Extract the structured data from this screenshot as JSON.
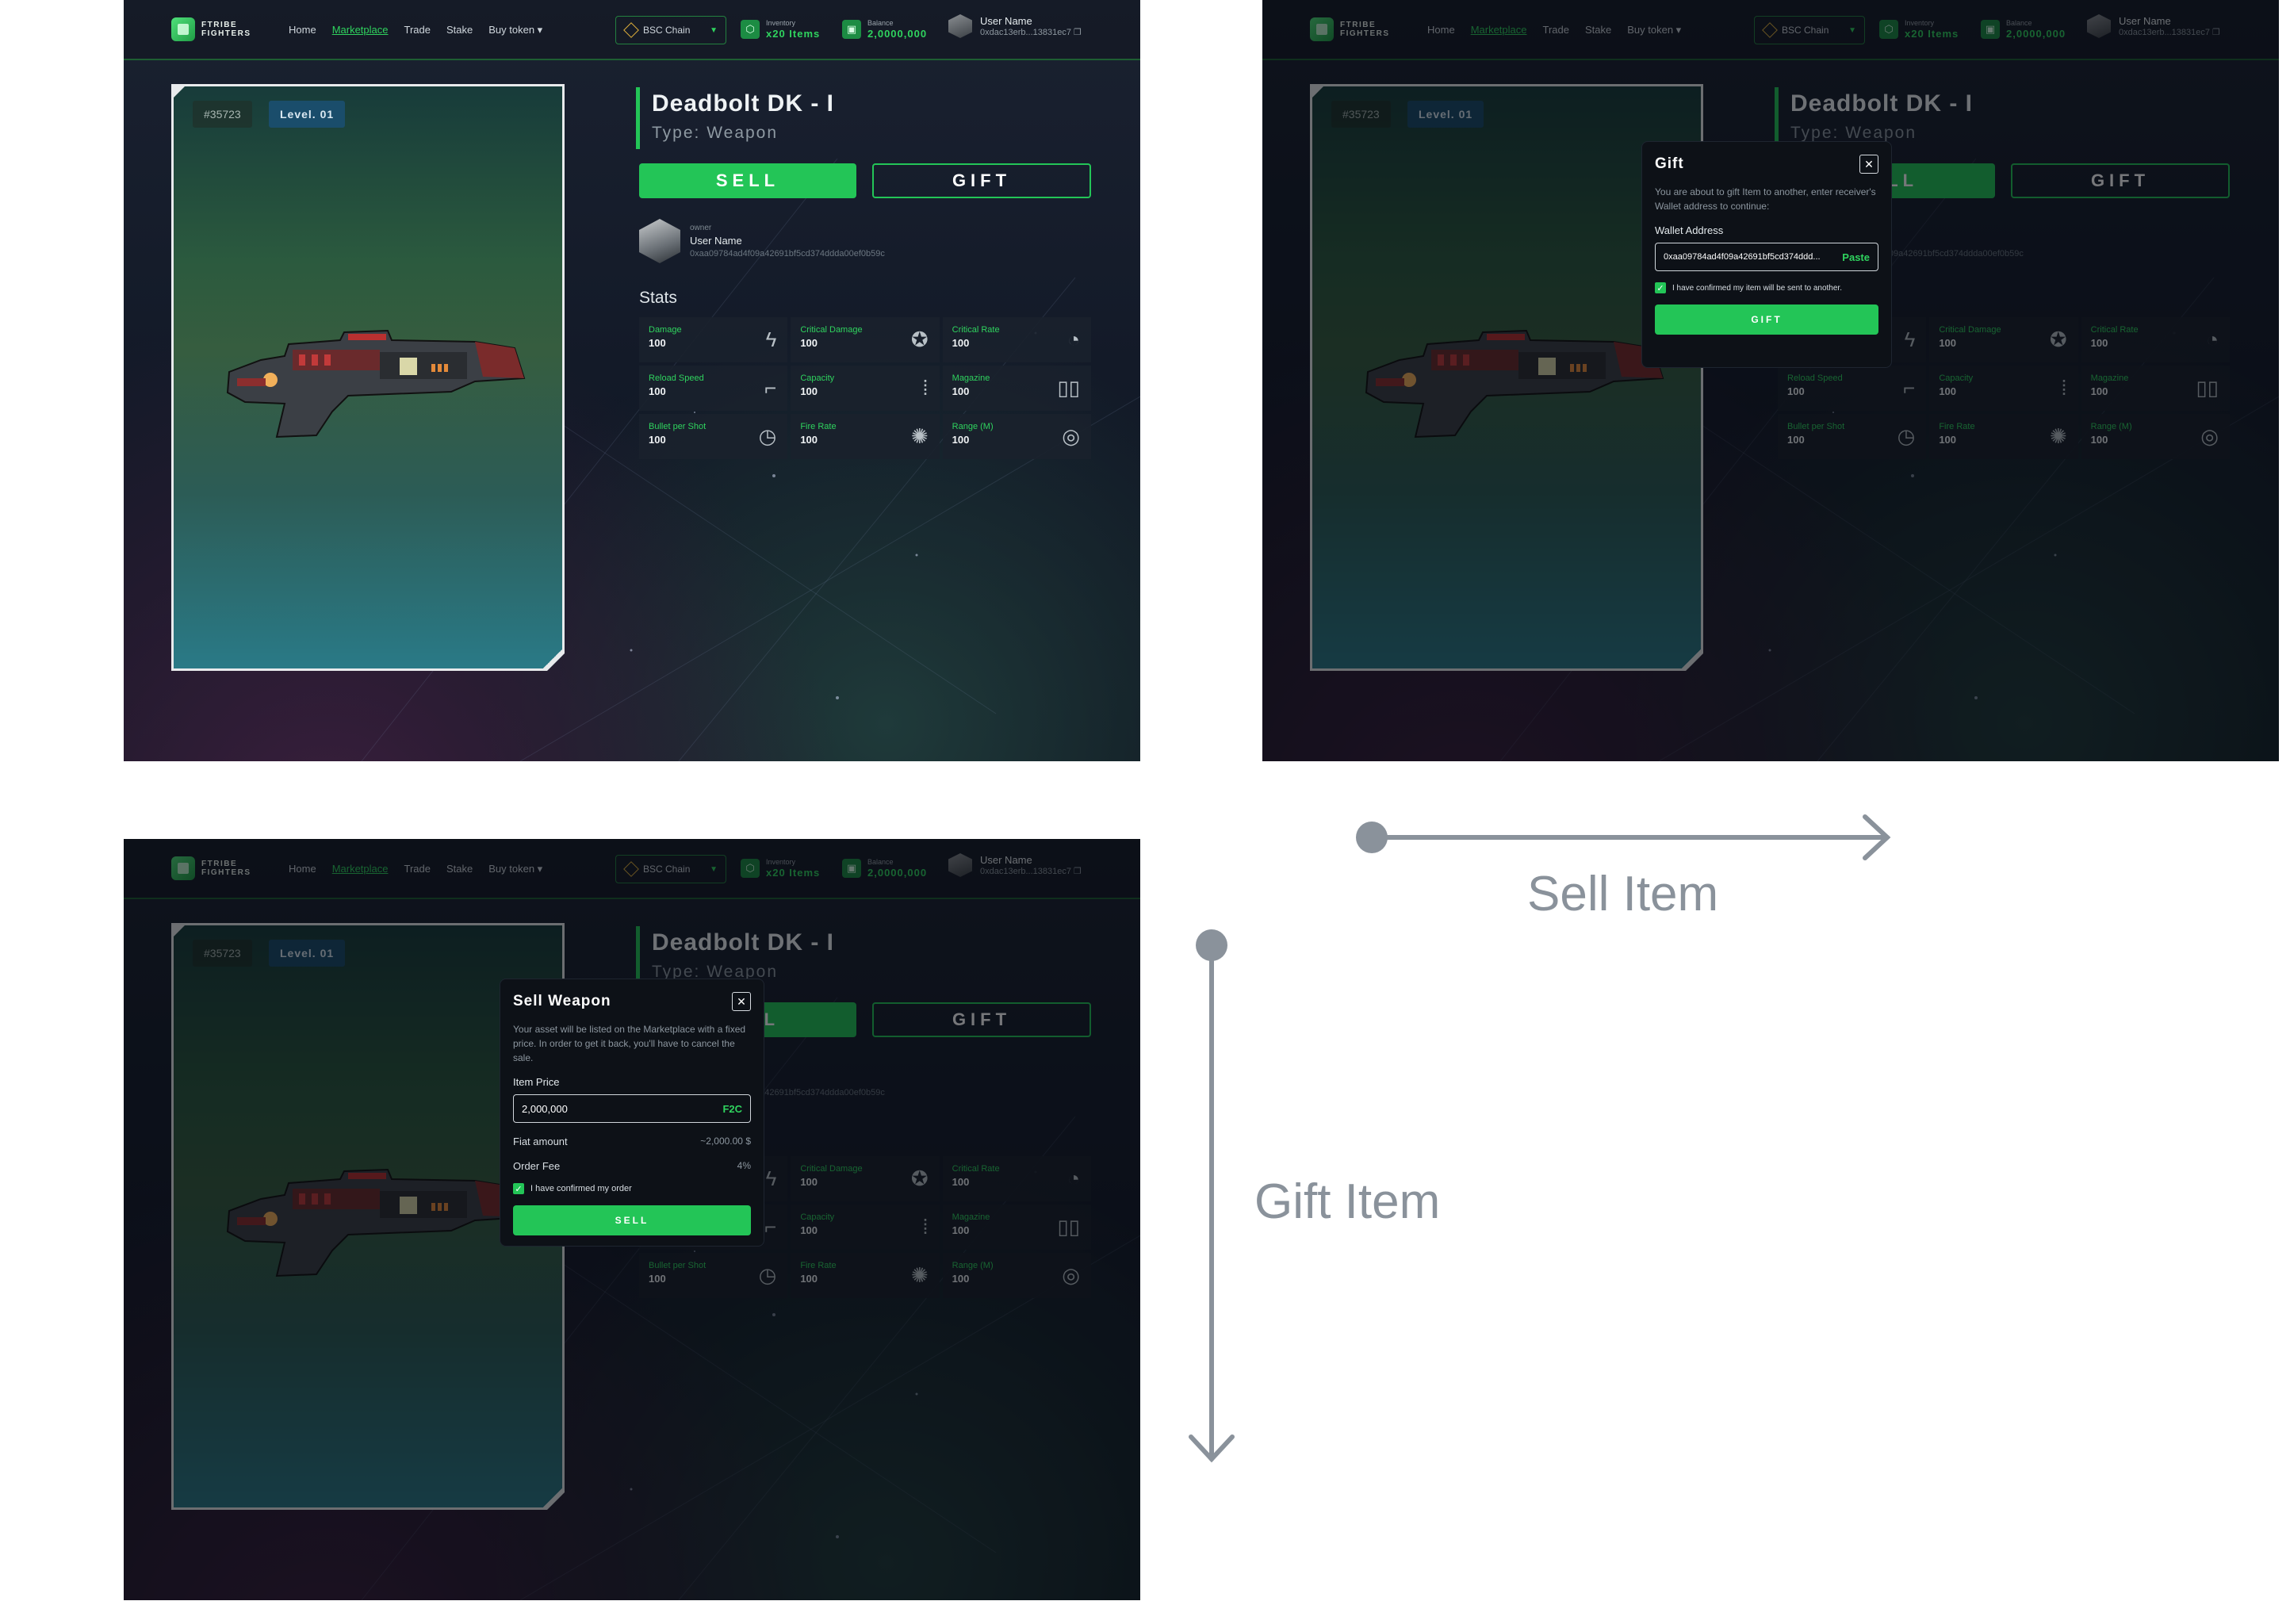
{
  "header": {
    "logo_text": "FTRIBE FIGHTERS",
    "nav": [
      "Home",
      "Marketplace",
      "Trade",
      "Stake",
      "Buy token ▾"
    ],
    "chain_label": "BSC Chain",
    "inventory_label": "Inventory",
    "inventory_value": "x20 Items",
    "balance_label": "Balance",
    "balance_value": "2,0000,000",
    "user_name": "User Name",
    "user_addr": "0xdac13erb...13831ec7"
  },
  "item": {
    "id_tag": "#35723",
    "level_tag": "Level. 01",
    "name": "Deadbolt DK - I",
    "type": "Type: Weapon",
    "sell_label": "SELL",
    "gift_label": "GIFT",
    "owner_label": "owner",
    "owner_name": "User Name",
    "owner_addr": "0xaa09784ad4f09a42691bf5cd374ddda00ef0b59c",
    "stats_title": "Stats",
    "stats": [
      {
        "label": "Damage",
        "value": "100",
        "icon": "lightning-icon"
      },
      {
        "label": "Critical Damage",
        "value": "100",
        "icon": "star-badge-icon"
      },
      {
        "label": "Critical Rate",
        "value": "100",
        "icon": "rate-dial-icon"
      },
      {
        "label": "Reload Speed",
        "value": "100",
        "icon": "pistol-icon"
      },
      {
        "label": "Capacity",
        "value": "100",
        "icon": "bullets-icon"
      },
      {
        "label": "Magazine",
        "value": "100",
        "icon": "magazine-icon"
      },
      {
        "label": "Bullet per Shot",
        "value": "100",
        "icon": "clock-bullet-icon"
      },
      {
        "label": "Fire Rate",
        "value": "100",
        "icon": "spinner-icon"
      },
      {
        "label": "Range (M)",
        "value": "100",
        "icon": "target-icon"
      }
    ]
  },
  "gift_modal": {
    "title": "Gift",
    "desc": "You are about to gift Item to another, enter receiver's Wallet address to continue:",
    "field_label": "Wallet Address",
    "field_value": "0xaa09784ad4f09a42691bf5cd374ddd...",
    "paste_label": "Paste",
    "confirm_text": "I have confirmed my item will be sent to another.",
    "button_label": "GIFT"
  },
  "sell_modal": {
    "title": "Sell Weapon",
    "desc": "Your asset will be listed on the Marketplace with a fixed price. In order to get it back, you'll have to cancel the sale.",
    "price_label": "Item Price",
    "price_value": "2,000,000",
    "price_suffix": "F2C",
    "fiat_label": "Fiat amount",
    "fiat_value": "~2,000.00 $",
    "fee_label": "Order Fee",
    "fee_value": "4%",
    "confirm_text": "I have confirmed my order",
    "button_label": "SELL"
  },
  "annotations": {
    "sell_item": "Sell Item",
    "gift_item": "Gift Item"
  },
  "colors": {
    "accent": "#23c557",
    "arrow": "#8a929b"
  }
}
